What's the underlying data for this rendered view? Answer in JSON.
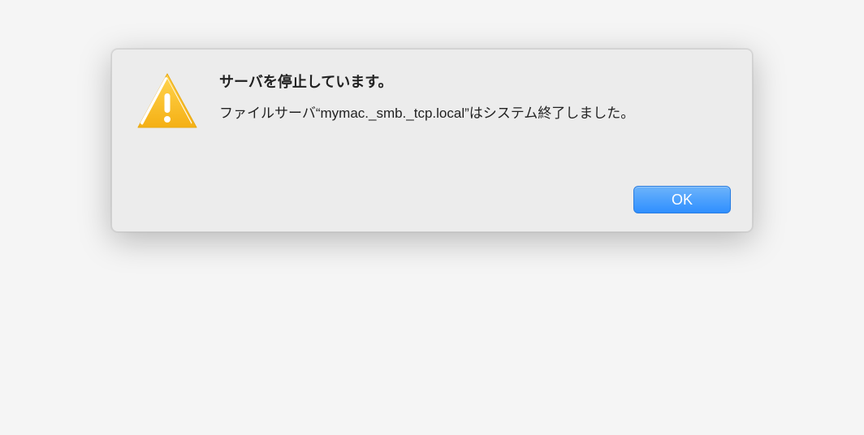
{
  "dialog": {
    "title": "サーバを停止しています。",
    "message": "ファイルサーバ“mymac._smb._tcp.local”はシステム終了しました。",
    "ok_label": "OK"
  }
}
